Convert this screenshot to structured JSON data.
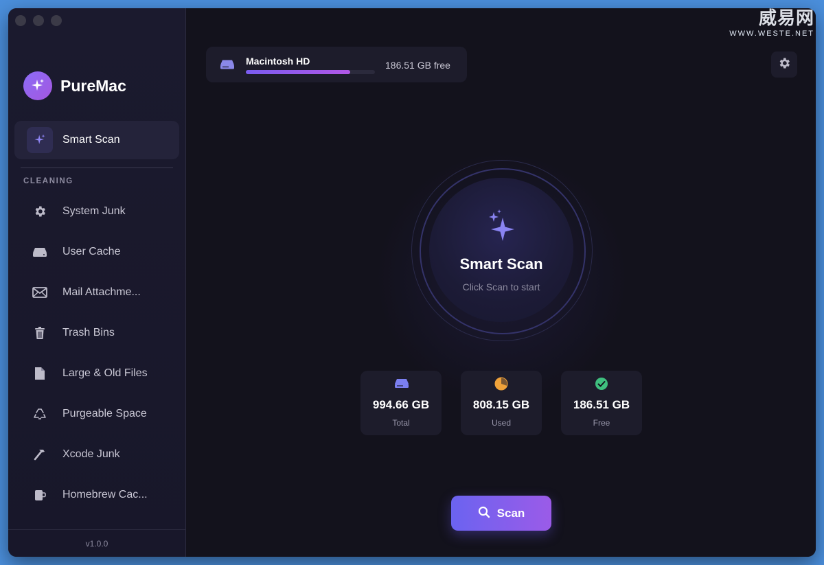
{
  "app": {
    "name": "PureMac",
    "version": "v1.0.0"
  },
  "sidebar": {
    "active_item": {
      "label": "Smart Scan",
      "icon": "sparkles-icon"
    },
    "section_title": "CLEANING",
    "items": [
      {
        "label": "System Junk",
        "icon": "gear-icon"
      },
      {
        "label": "User Cache",
        "icon": "drive-icon"
      },
      {
        "label": "Mail Attachme...",
        "icon": "envelope-icon"
      },
      {
        "label": "Trash Bins",
        "icon": "trash-icon"
      },
      {
        "label": "Large & Old Files",
        "icon": "document-icon"
      },
      {
        "label": "Purgeable Space",
        "icon": "recycle-icon"
      },
      {
        "label": "Xcode Junk",
        "icon": "hammer-icon"
      },
      {
        "label": "Homebrew Cac...",
        "icon": "mug-icon"
      }
    ]
  },
  "disk": {
    "name": "Macintosh HD",
    "free_label": "186.51 GB free",
    "used_fraction": 0.81
  },
  "scan_panel": {
    "title": "Smart Scan",
    "subtitle": "Click Scan to start"
  },
  "stats": [
    {
      "value": "994.66 GB",
      "label": "Total",
      "icon": "drive-icon",
      "color": "#7b7ff0"
    },
    {
      "value": "808.15 GB",
      "label": "Used",
      "icon": "pie-chart-icon",
      "color": "#f0a23a"
    },
    {
      "value": "186.51 GB",
      "label": "Free",
      "icon": "check-circle-icon",
      "color": "#3fbf7f"
    }
  ],
  "scan_button": {
    "label": "Scan",
    "icon": "search-icon"
  },
  "watermark": {
    "logo_text": "威易网",
    "url_text": "WWW.WESTE.NET"
  },
  "colors": {
    "accent": "#7b6cf0",
    "accent_end": "#a457e0",
    "background": "#13121c",
    "sidebar": "#1b1a2e"
  }
}
